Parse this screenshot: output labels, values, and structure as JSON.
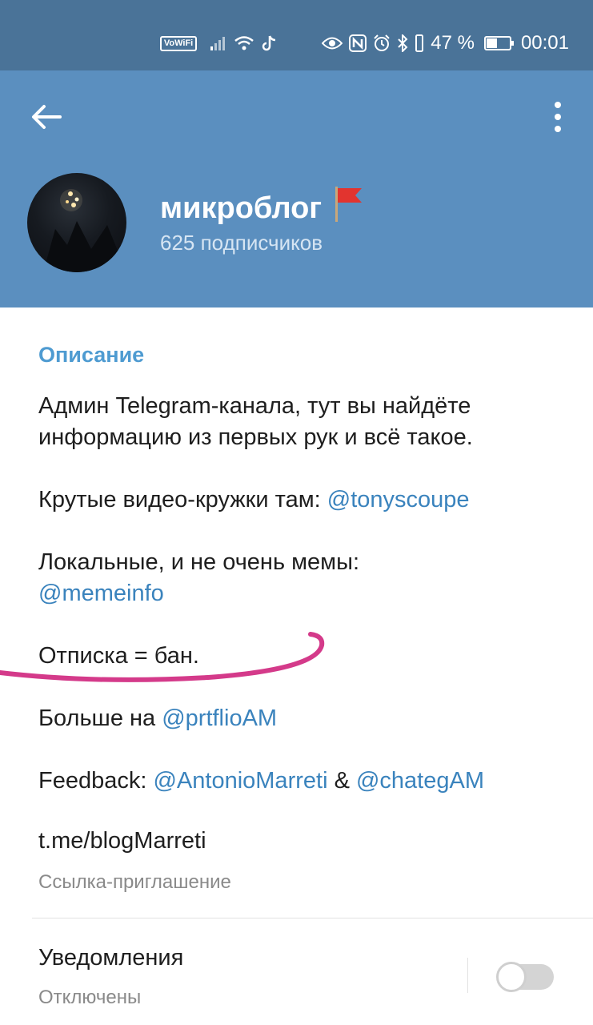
{
  "status_bar": {
    "vowifi_label": "VoWiFi",
    "battery_text": "47 %",
    "battery_level": 0.47,
    "time": "00:01",
    "icons": [
      "signal-icon",
      "wifi-icon",
      "tiktok-icon",
      "eye-icon",
      "nfc-icon",
      "alarm-icon",
      "bluetooth-icon",
      "vibrate-icon",
      "battery-icon"
    ]
  },
  "header": {
    "channel_name": "микроблог",
    "flag_emoji": "🚩",
    "subscribers": "625 подписчиков",
    "colors": {
      "header_bg": "#5b8fbf",
      "status_bg": "#4a7398"
    }
  },
  "description": {
    "section_title": "Описание",
    "paragraphs": [
      {
        "text": "Админ Telegram-канала, тут вы найдёте информацию из первых рук и всё такое."
      },
      {
        "prefix": "Крутые видео-кружки там: ",
        "mention": "@tonyscoupe"
      },
      {
        "prefix": "Локальные, и не очень мемы: ",
        "mention": "@memeinfo"
      },
      {
        "text": "Отписка = бан."
      },
      {
        "prefix": "Больше на ",
        "mention": "@prtflioAM"
      },
      {
        "prefix": "Feedback: ",
        "mention": "@AntonioMarreti",
        "joiner": " & ",
        "mention2": "@chategAM"
      }
    ],
    "accent_color": "#4e9bd1",
    "link_color": "#3a83bd"
  },
  "invite_link": {
    "value": "t.me/blogMarreti",
    "label": "Ссылка-приглашение"
  },
  "notifications": {
    "title": "Уведомления",
    "status": "Отключены",
    "enabled": false
  }
}
